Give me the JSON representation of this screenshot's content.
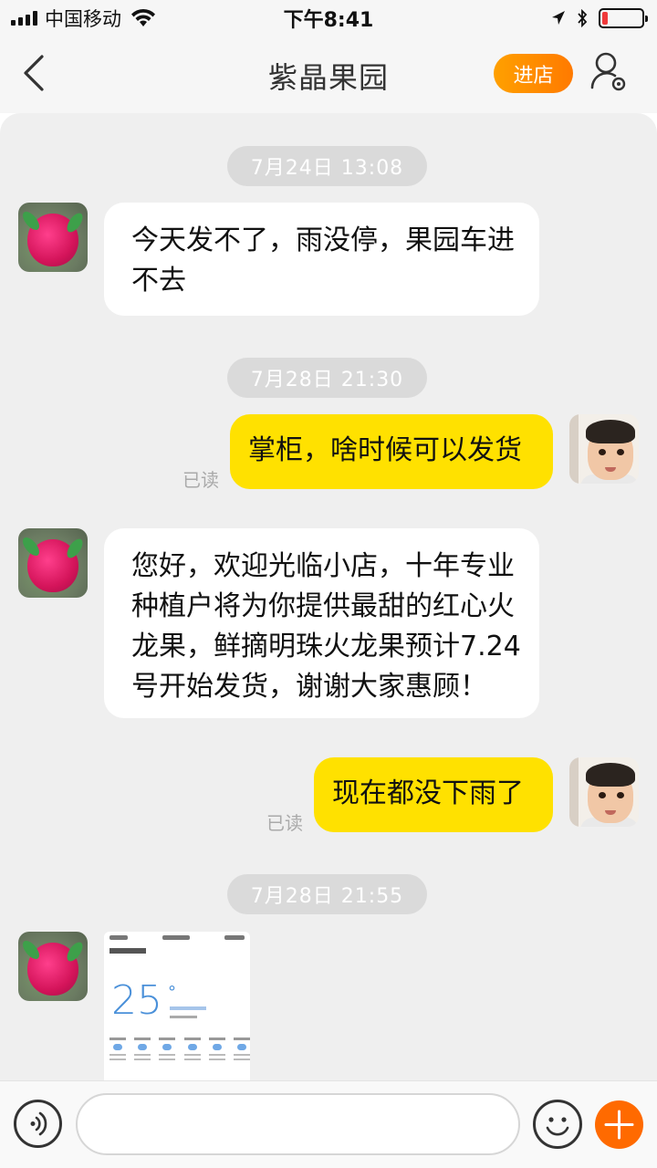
{
  "status_bar": {
    "carrier": "中国移动",
    "time": "下午8:41",
    "battery_level": 0.15,
    "battery_color": "#f0393a"
  },
  "nav": {
    "back_icon": "chevron-left-icon",
    "title": "紫晶果园",
    "shop_button": "进店",
    "profile_icon": "user-settings-icon",
    "accent": "#ff8c00"
  },
  "messages": [
    {
      "type": "time",
      "text": "7月24日 13:08"
    },
    {
      "type": "incoming",
      "text": "今天发不了，雨没停，果园车进不去",
      "avatar": "dragon-fruit-avatar"
    },
    {
      "type": "time",
      "text": "7月28日 21:30"
    },
    {
      "type": "outgoing",
      "text": "掌柜，啥时候可以发货",
      "read": "已读",
      "avatar": "boy-avatar"
    },
    {
      "type": "incoming",
      "text": "您好，欢迎光临小店，十年专业种植户将为你提供最甜的红心火龙果，鲜摘明珠火龙果预计7.24号开始发货，谢谢大家惠顾！",
      "avatar": "dragon-fruit-avatar"
    },
    {
      "type": "outgoing",
      "text": "现在都没下雨了",
      "read": "已读",
      "avatar": "boy-avatar"
    },
    {
      "type": "time",
      "text": "7月28日 21:55"
    },
    {
      "type": "image",
      "avatar": "dragon-fruit-avatar",
      "image_desc_temp": "25"
    }
  ],
  "bubble_colors": {
    "incoming": "#ffffff",
    "outgoing": "#ffe100"
  },
  "input_bar": {
    "voice_icon": "voice-icon",
    "placeholder": "",
    "emoji_icon": "emoji-icon",
    "plus_icon": "plus-icon"
  }
}
